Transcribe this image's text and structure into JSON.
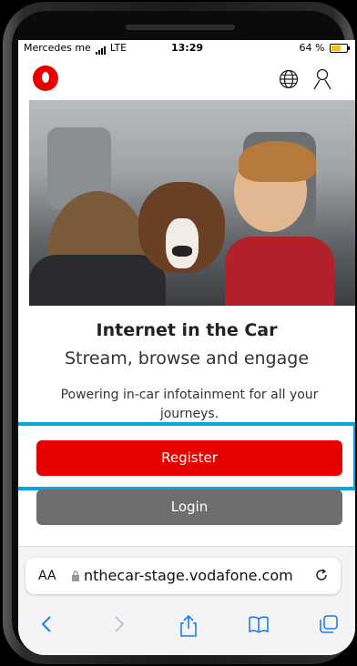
{
  "status_bar": {
    "carrier": "Mercedes me",
    "network": "LTE",
    "time": "13:29",
    "battery": "64 %",
    "battery_color": "#f5c400"
  },
  "header": {
    "logo": "vodafone-logo",
    "icons": [
      "globe-icon",
      "user-icon"
    ],
    "brand_color": "#e60000"
  },
  "hero": {
    "image": "children-with-dog-in-car-photo"
  },
  "content": {
    "headline": "Internet in the Car",
    "subhead": "Stream, browse and engage",
    "description": "Powering in-car infotainment for all your journeys."
  },
  "actions": {
    "register_label": "Register",
    "login_label": "Login",
    "register_color": "#e60000",
    "login_color": "#6e6e6e",
    "highlight_color": "#00a6e0"
  },
  "browser": {
    "aa_label": "AA",
    "url": "nthecar-stage.vodafone.com",
    "icons": [
      "lock-icon",
      "reload-icon",
      "back-icon",
      "forward-icon",
      "share-icon",
      "bookmarks-icon",
      "tabs-icon"
    ]
  }
}
